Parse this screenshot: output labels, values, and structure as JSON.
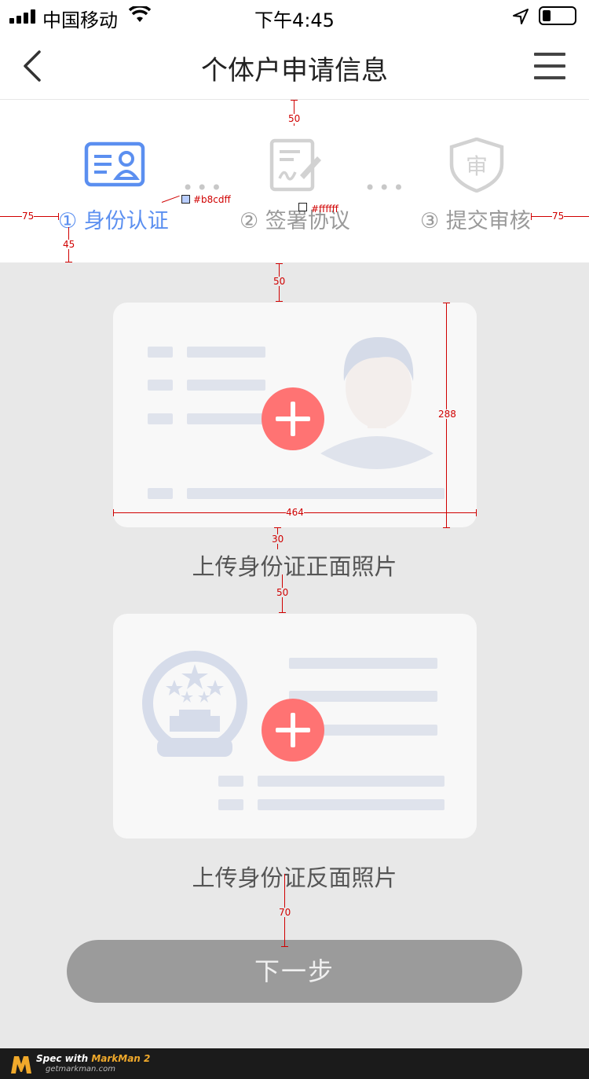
{
  "status_bar": {
    "carrier": "中国移动",
    "time": "下午4:45"
  },
  "nav": {
    "title": "个体户申请信息"
  },
  "steps": [
    {
      "label": "① 身份认证",
      "state": "active"
    },
    {
      "label": "② 签署协议",
      "state": "inactive"
    },
    {
      "label": "③ 提交审核",
      "state": "inactive"
    }
  ],
  "step_icons": [
    "id-card-icon",
    "sign-document-icon",
    "shield-review-icon"
  ],
  "cards": {
    "front_caption": "上传身份证正面照片",
    "back_caption": "上传身份证反面照片"
  },
  "next_button": {
    "label": "下一步"
  },
  "colors": {
    "accent": "#5b8ff0",
    "plus": "#ff7373",
    "next_button_bg": "#9b9b9b",
    "annotation": "#d00000"
  },
  "annotations": {
    "m_50_top": "50",
    "m_75_left": "75",
    "m_75_right": "75",
    "m_45": "45",
    "color_active": "#b8cdff",
    "color_white": "#ffffff",
    "m_50_card": "50",
    "card_height": "288",
    "card_width": "464",
    "m_30": "30",
    "m_50_between": "50",
    "m_70": "70"
  },
  "footer": {
    "spec_prefix": "Spec with ",
    "spec_brand": "MarkMan 2",
    "url": "getmarkman.com"
  }
}
